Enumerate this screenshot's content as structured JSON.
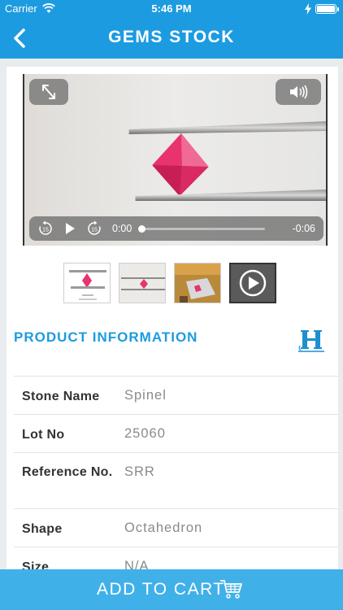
{
  "status_bar": {
    "carrier": "Carrier",
    "time": "5:46 PM",
    "battery_level": 1.0
  },
  "nav": {
    "title": "GEMS STOCK",
    "back_icon": "chevron-left-icon"
  },
  "video": {
    "current_time": "0:00",
    "remaining_time": "-0:06",
    "progress": 0.0,
    "controls": [
      "expand-icon",
      "volume-icon",
      "skip-back-15-icon",
      "play-icon",
      "skip-forward-15-icon"
    ]
  },
  "thumbnails": [
    {
      "name": "gem-photo-1"
    },
    {
      "name": "gem-photo-2"
    },
    {
      "name": "gem-photo-3"
    },
    {
      "name": "video",
      "selected": true
    }
  ],
  "product_info": {
    "heading": "PRODUCT INFORMATION",
    "rows": [
      {
        "label": "Stone Name",
        "value": "Spinel"
      },
      {
        "label": "Lot No",
        "value": "25060"
      },
      {
        "label": "Reference No.",
        "value": "SRR"
      },
      {
        "label": "Shape",
        "value": "Octahedron"
      },
      {
        "label": "Size",
        "value": "N/A"
      }
    ]
  },
  "cart": {
    "label": "ADD TO CART"
  },
  "colors": {
    "primary": "#1d9be0",
    "cart_bar": "#40b0e8",
    "gem": "#e8336e",
    "background": "#e9ecef"
  }
}
